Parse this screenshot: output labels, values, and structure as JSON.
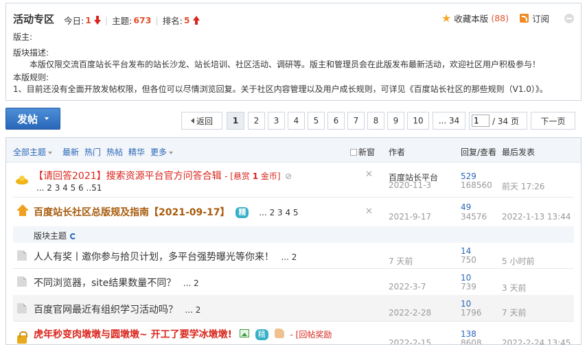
{
  "forum": {
    "title": "活动专区",
    "today_label": "今日:",
    "today_value": "1",
    "topics_label": "主题:",
    "topics_value": "673",
    "rank_label": "排名:",
    "rank_value": "5",
    "favorite_label": "收藏本版",
    "favorite_count": "(88)",
    "subscribe_label": "订阅",
    "moderator_label": "版主:",
    "description_label": "版块描述:",
    "description_text": "本版仅限交流百度站长平台发布的站长沙龙、站长培训、社区活动、调研等。版主和管理员会在此版发布最新活动，欢迎社区用户积极参与！",
    "rules_label": "本版规则:",
    "rules_text": "1、目前还没有全面开放发帖权限，但各位可以尽情浏览回复。关于社区内容管理以及用户成长规则，可详见《百度站长社区的那些规则（V1.0）》。"
  },
  "toolbar": {
    "post_label": "发帖",
    "prev_label": "返回",
    "pages": [
      "1",
      "2",
      "3",
      "4",
      "5",
      "6",
      "7",
      "8",
      "9",
      "10",
      "... 34"
    ],
    "current_page": "1",
    "total_pages": "/ 34 页",
    "next_label": "下一页"
  },
  "list_header": {
    "all": "全部主题",
    "latest": "最新",
    "hot": "热门",
    "trending": "热帖",
    "digest": "精华",
    "more": "更多",
    "new_window": "新窗",
    "author": "作者",
    "replies_views": "回复/查看",
    "last_post": "最后发表"
  },
  "threads": [
    {
      "subject": "【请回答2021】搜索资源平台官方问答合辑",
      "bounty_prefix": "- [悬赏 ",
      "bounty_value": "1",
      "bounty_suffix": " 金币]",
      "pages": "... 2  3  4  5  6  ..51",
      "author": "百度站长平台",
      "date": "2020-11-3",
      "replies": "529",
      "views": "168560",
      "last_user": "",
      "last_time": "前天 17:26"
    },
    {
      "subject": "百度站长社区总版规及指南【2021-09-17】",
      "badge": "精",
      "pages": "... 2  3  4  5",
      "author": "",
      "date": "2021-9-17",
      "replies": "49",
      "views": "34576",
      "last_user": "",
      "last_time": "2022-1-13 13:44"
    },
    {
      "subject": "人人有奖丨邀你参与拾贝计划，多平台强势曝光等你来！",
      "pages": "... 2",
      "author": "",
      "date": "7 天前",
      "replies": "14",
      "views": "750",
      "last_user": "",
      "last_time": "5 小时前"
    },
    {
      "subject": "不同浏览器，site结果数量不同？",
      "pages": "... 2",
      "author": "",
      "date": "2022-3-7",
      "replies": "10",
      "views": "739",
      "last_user": "",
      "last_time": "3 天前"
    },
    {
      "subject": "百度官网最近有组织学习活动吗？",
      "pages": "... 2",
      "author": "",
      "date": "2022-2-28",
      "replies": "10",
      "views": "1796",
      "last_user": "",
      "last_time": "7 天前"
    },
    {
      "subject": "虎年秒变肉墩墩与圆墩墩~ 开工了要学冰墩墩!",
      "badge": "精",
      "bounty_prefix": "- [回帖奖励",
      "pages": "",
      "author": "",
      "date": "2022-2-15",
      "replies": "138",
      "views": "8608",
      "last_user": "",
      "last_time": "2022-2-24 13:45"
    }
  ],
  "section": {
    "label": "版块主题"
  },
  "icons": {
    "favorite": "star-icon",
    "subscribe": "rss-icon",
    "close": "close-circle-icon",
    "rank_trend": "arrow-up-icon",
    "today_trend": "arrow-down-icon"
  },
  "colors": {
    "accent_blue": "#2966b8",
    "red": "#d9261c",
    "orange": "#e0522c",
    "brown": "#a75b0c"
  }
}
